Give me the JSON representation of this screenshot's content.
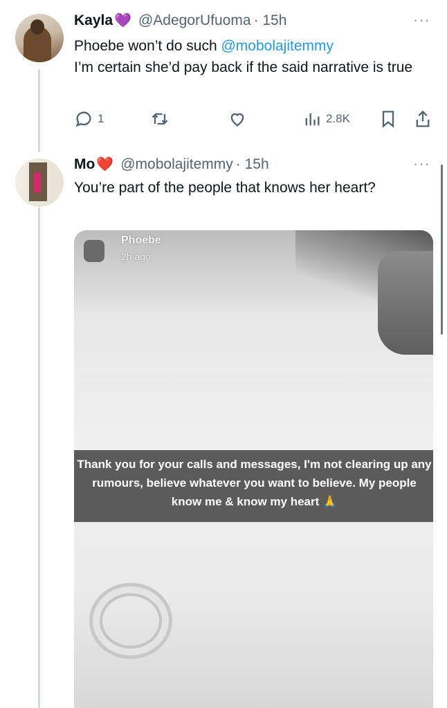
{
  "tweets": [
    {
      "name": "Kayla",
      "emoji": "💜",
      "handle": "@AdegorUfuoma",
      "time": "· 15h",
      "text_pre": "Phoebe won’t do such ",
      "mention": "@mobolajitemmy",
      "text_post": "I’m certain she’d pay back if the said narrative is true",
      "more": "···",
      "replies": "1",
      "views": "2.8K"
    },
    {
      "name": "Mo",
      "emoji": "❤️",
      "handle": "@mobolajitemmy",
      "time": "· 15h",
      "text": "You’re part of the people that knows her heart?",
      "more": "···",
      "media": {
        "story_name": "Phoebe",
        "story_time": "2h ago",
        "caption": "Thank you for your calls and messages, I'm not clearing up any rumours, believe whatever you want to believe. My people know me & know my heart 🙏"
      }
    }
  ]
}
